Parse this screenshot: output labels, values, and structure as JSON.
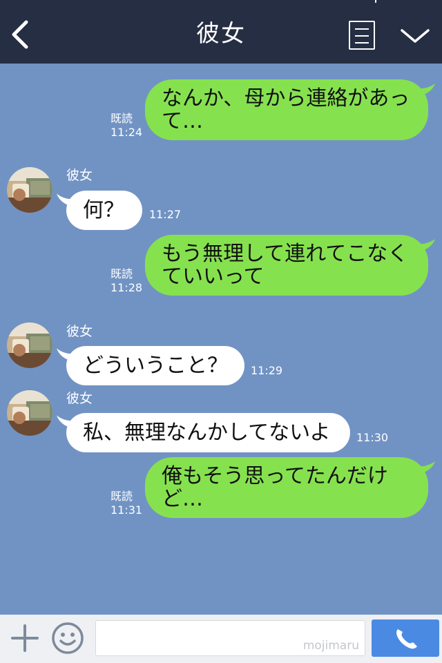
{
  "header": {
    "title": "彼女",
    "back_icon": "chevron-left-icon",
    "menu_icon": "list-icon",
    "expand_icon": "chevron-down-icon"
  },
  "colors": {
    "header_bg": "#252e42",
    "chat_bg": "#7193c4",
    "outgoing_bubble": "#86e14f",
    "incoming_bubble": "#ffffff",
    "call_button": "#4a8ae3"
  },
  "messages": [
    {
      "direction": "out",
      "text": "なんか、母から連絡があって…",
      "read": "既読",
      "time": "11:24"
    },
    {
      "direction": "in",
      "sender": "彼女",
      "text": "何？",
      "time": "11:27"
    },
    {
      "direction": "out",
      "text": "もう無理して連れてこなくていいって",
      "read": "既読",
      "time": "11:28"
    },
    {
      "direction": "in",
      "sender": "彼女",
      "text": "どういうこと？",
      "time": "11:29"
    },
    {
      "direction": "in",
      "sender": "彼女",
      "text": "私、無理なんかしてないよ",
      "time": "11:30"
    },
    {
      "direction": "out",
      "text": "俺もそう思ってたんだけど…",
      "read": "既読",
      "time": "11:31"
    }
  ],
  "footer": {
    "plus_icon": "plus-icon",
    "emoji_icon": "smiley-icon",
    "input_value": "",
    "watermark": "mojimaru",
    "call_icon": "phone-icon"
  }
}
